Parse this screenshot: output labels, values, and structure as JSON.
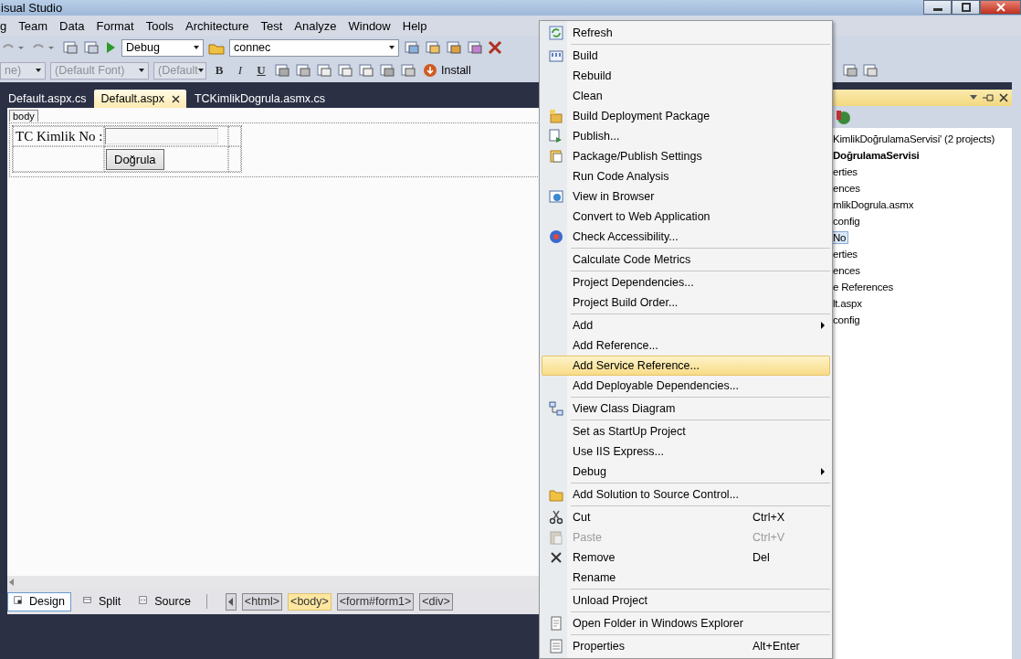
{
  "window": {
    "title": "isual Studio"
  },
  "menu_bar": [
    "g",
    "Team",
    "Data",
    "Format",
    "Tools",
    "Architecture",
    "Test",
    "Analyze",
    "Window",
    "Help"
  ],
  "toolbar": {
    "configuration": "Debug",
    "search_combo": "connec"
  },
  "format_toolbar": {
    "block_format": "ne)",
    "font": "(Default Font)",
    "size": "(Default",
    "bold": "B",
    "italic": "I",
    "underline": "U",
    "install_button": "Install"
  },
  "tabs": [
    {
      "label": "Default.aspx.cs",
      "selected": false
    },
    {
      "label": "Default.aspx",
      "selected": true
    },
    {
      "label": "TCKimlikDogrula.asmx.cs",
      "selected": false
    }
  ],
  "designer": {
    "tag_label": "body",
    "field_label": "TC Kimlik No :",
    "button": "Doğrula"
  },
  "view_tabs": [
    {
      "label": "Design",
      "selected": true
    },
    {
      "label": "Split",
      "selected": false
    },
    {
      "label": "Source",
      "selected": false
    }
  ],
  "breadcrumbs": [
    {
      "label": "<html>",
      "selected": false
    },
    {
      "label": "<body>",
      "selected": true
    },
    {
      "label": "<form#form1>",
      "selected": false
    },
    {
      "label": "<div>",
      "selected": false
    }
  ],
  "solution_explorer": {
    "tree": [
      {
        "label": "KimlikDoğrulamaServisi' (2 projects)",
        "bold": false,
        "selected": false,
        "children": [
          {
            "label": "DoğrulamaServisi",
            "bold": true,
            "selected": false,
            "children": [
              {
                "label": "erties",
                "bold": false,
                "selected": false
              },
              {
                "label": "ences",
                "bold": false,
                "selected": false
              },
              {
                "label": "mlikDogrula.asmx",
                "bold": false,
                "selected": false
              },
              {
                "label": "config",
                "bold": false,
                "selected": false
              }
            ]
          },
          {
            "label": "No",
            "bold": false,
            "selected": true,
            "children": [
              {
                "label": "erties",
                "bold": false,
                "selected": false
              },
              {
                "label": "ences",
                "bold": false,
                "selected": false
              },
              {
                "label": "e References",
                "bold": false,
                "selected": false
              },
              {
                "label": "lt.aspx",
                "bold": false,
                "selected": false
              },
              {
                "label": "config",
                "bold": false,
                "selected": false
              }
            ]
          }
        ]
      }
    ]
  },
  "context_menu": [
    {
      "kind": "item",
      "label": "Refresh",
      "submenu": false,
      "disabled": false,
      "selected": false
    },
    {
      "kind": "separator"
    },
    {
      "kind": "item",
      "label": "Build",
      "submenu": false,
      "disabled": false,
      "selected": false
    },
    {
      "kind": "item",
      "label": "Rebuild",
      "submenu": false,
      "disabled": false,
      "selected": false
    },
    {
      "kind": "item",
      "label": "Clean",
      "submenu": false,
      "disabled": false,
      "selected": false
    },
    {
      "kind": "item",
      "label": "Build Deployment Package",
      "submenu": false,
      "disabled": false,
      "selected": false
    },
    {
      "kind": "item",
      "label": "Publish...",
      "submenu": false,
      "disabled": false,
      "selected": false
    },
    {
      "kind": "item",
      "label": "Package/Publish Settings",
      "submenu": false,
      "disabled": false,
      "selected": false
    },
    {
      "kind": "item",
      "label": "Run Code Analysis",
      "submenu": false,
      "disabled": false,
      "selected": false
    },
    {
      "kind": "item",
      "label": "View in Browser",
      "submenu": false,
      "disabled": false,
      "selected": false
    },
    {
      "kind": "item",
      "label": "Convert to Web Application",
      "submenu": false,
      "disabled": false,
      "selected": false
    },
    {
      "kind": "item",
      "label": "Check Accessibility...",
      "submenu": false,
      "disabled": false,
      "selected": false
    },
    {
      "kind": "separator"
    },
    {
      "kind": "item",
      "label": "Calculate Code Metrics",
      "submenu": false,
      "disabled": false,
      "selected": false
    },
    {
      "kind": "separator"
    },
    {
      "kind": "item",
      "label": "Project Dependencies...",
      "submenu": false,
      "disabled": false,
      "selected": false
    },
    {
      "kind": "item",
      "label": "Project Build Order...",
      "submenu": false,
      "disabled": false,
      "selected": false
    },
    {
      "kind": "separator"
    },
    {
      "kind": "item",
      "label": "Add",
      "submenu": true,
      "disabled": false,
      "selected": false
    },
    {
      "kind": "item",
      "label": "Add Reference...",
      "submenu": false,
      "disabled": false,
      "selected": false
    },
    {
      "kind": "item",
      "label": "Add Service Reference...",
      "submenu": false,
      "disabled": false,
      "selected": true
    },
    {
      "kind": "item",
      "label": "Add Deployable Dependencies...",
      "submenu": false,
      "disabled": false,
      "selected": false
    },
    {
      "kind": "separator"
    },
    {
      "kind": "item",
      "label": "View Class Diagram",
      "submenu": false,
      "disabled": false,
      "selected": false
    },
    {
      "kind": "separator"
    },
    {
      "kind": "item",
      "label": "Set as StartUp Project",
      "submenu": false,
      "disabled": false,
      "selected": false
    },
    {
      "kind": "item",
      "label": "Use IIS Express...",
      "submenu": false,
      "disabled": false,
      "selected": false
    },
    {
      "kind": "item",
      "label": "Debug",
      "submenu": true,
      "disabled": false,
      "selected": false
    },
    {
      "kind": "separator"
    },
    {
      "kind": "item",
      "label": "Add Solution to Source Control...",
      "submenu": false,
      "disabled": false,
      "selected": false
    },
    {
      "kind": "separator"
    },
    {
      "kind": "item",
      "label": "Cut",
      "shortcut": "Ctrl+X",
      "submenu": false,
      "disabled": false,
      "selected": false
    },
    {
      "kind": "item",
      "label": "Paste",
      "shortcut": "Ctrl+V",
      "submenu": false,
      "disabled": true,
      "selected": false
    },
    {
      "kind": "item",
      "label": "Remove",
      "shortcut": "Del",
      "submenu": false,
      "disabled": false,
      "selected": false
    },
    {
      "kind": "item",
      "label": "Rename",
      "submenu": false,
      "disabled": false,
      "selected": false
    },
    {
      "kind": "separator"
    },
    {
      "kind": "item",
      "label": "Unload Project",
      "submenu": false,
      "disabled": false,
      "selected": false
    },
    {
      "kind": "separator"
    },
    {
      "kind": "item",
      "label": "Open Folder in Windows Explorer",
      "submenu": false,
      "disabled": false,
      "selected": false
    },
    {
      "kind": "separator"
    },
    {
      "kind": "item",
      "label": "Properties",
      "shortcut": "Alt+Enter",
      "submenu": false,
      "disabled": false,
      "selected": false
    }
  ]
}
